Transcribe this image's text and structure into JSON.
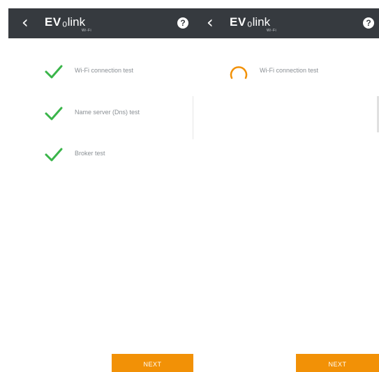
{
  "app": {
    "brand_ev": "EV",
    "brand_link": "link",
    "brand_sub": "Wi-Fi"
  },
  "colors": {
    "appbar": "#363a3f",
    "accent": "#f29106",
    "success": "#3ab54a",
    "label": "#8a8f94"
  },
  "icons": {
    "back": "chevron-left-icon",
    "help": "question-mark-icon",
    "passed": "checkmark-icon",
    "running": "spinner-icon"
  },
  "help_glyph": "?",
  "left_panel": {
    "tests": [
      {
        "label": "Wi-Fi connection test",
        "status": "passed"
      },
      {
        "label": "Name server (Dns) test",
        "status": "passed"
      },
      {
        "label": "Broker test",
        "status": "passed"
      }
    ],
    "next_label": "NEXT"
  },
  "right_panel": {
    "tests": [
      {
        "label": "Wi-Fi connection test",
        "status": "running"
      }
    ],
    "next_label": "NEXT"
  }
}
